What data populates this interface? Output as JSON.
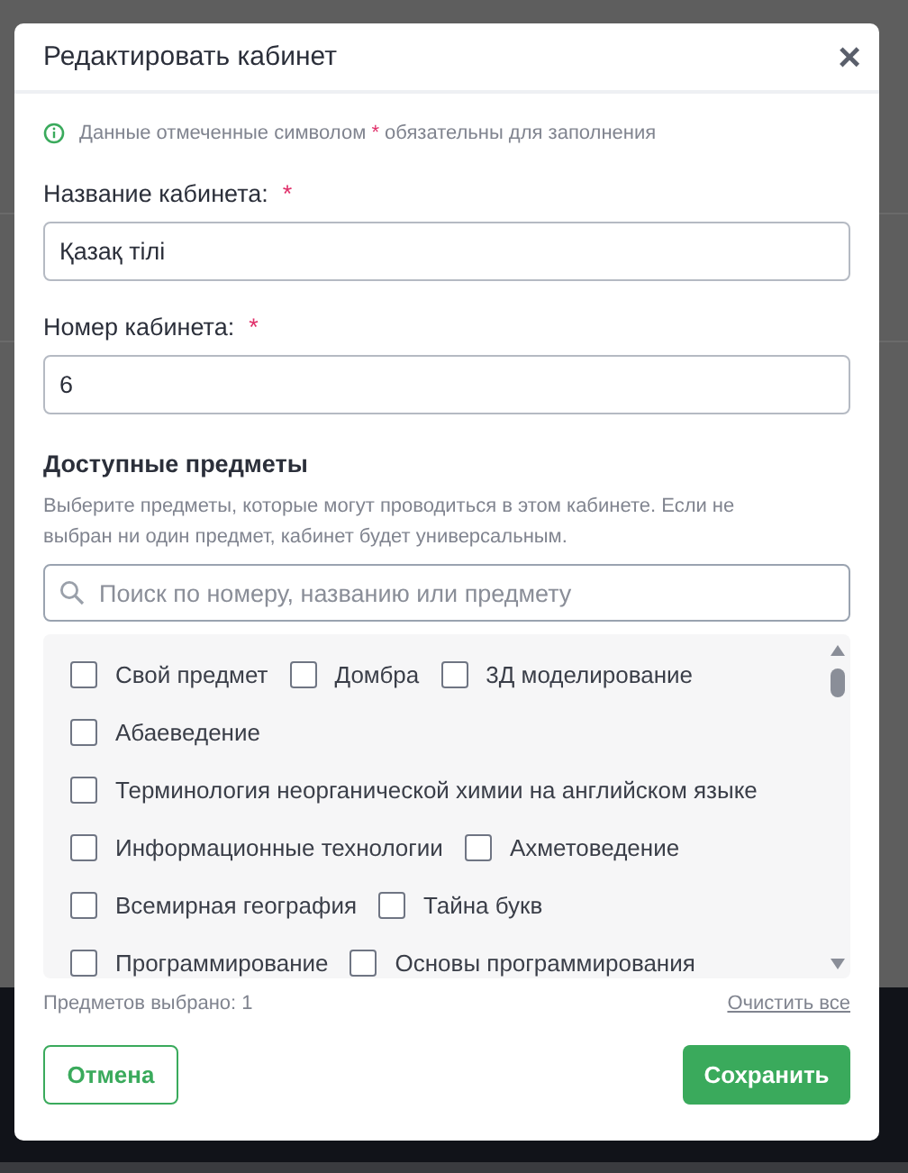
{
  "modal": {
    "title": "Редактировать кабинет",
    "close": "×",
    "notice": {
      "before": "Данные отмеченные символом",
      "mark": "*",
      "after": "обязательны для заполнения"
    },
    "fields": [
      {
        "label": "Название кабинета:",
        "required": true,
        "value": "Қазақ тілі"
      },
      {
        "label": "Номер кабинета:",
        "required": true,
        "value": "6"
      }
    ],
    "subjects": {
      "heading": "Доступные предметы",
      "description": "Выберите предметы, которые могут проводиться в этом кабинете. Если не выбран ни один предмет, кабинет будет универсальным.",
      "search": {
        "placeholder": "Поиск по номеру, названию или предмету"
      },
      "rows": [
        [
          {
            "label": "Свой предмет",
            "checked": false
          },
          {
            "label": "Домбра",
            "checked": false
          },
          {
            "label": "3Д моделирование",
            "checked": false
          }
        ],
        [
          {
            "label": "Абаеведение",
            "checked": false
          }
        ],
        [
          {
            "label": "Терминология неорганической химии на английском языке",
            "checked": false
          }
        ],
        [
          {
            "label": "Информационные технологии",
            "checked": false
          },
          {
            "label": "Ахметоведение",
            "checked": false
          }
        ],
        [
          {
            "label": "Всемирная география",
            "checked": false
          },
          {
            "label": "Тайна букв",
            "checked": false
          }
        ],
        [
          {
            "label": "Программирование",
            "checked": false
          },
          {
            "label": "Основы программирования",
            "checked": false
          }
        ]
      ],
      "selected_count": "Предметов выбрано: 1",
      "clear_all": "Очистить все"
    },
    "buttons": {
      "cancel": "Отмена",
      "save": "Сохранить"
    }
  }
}
